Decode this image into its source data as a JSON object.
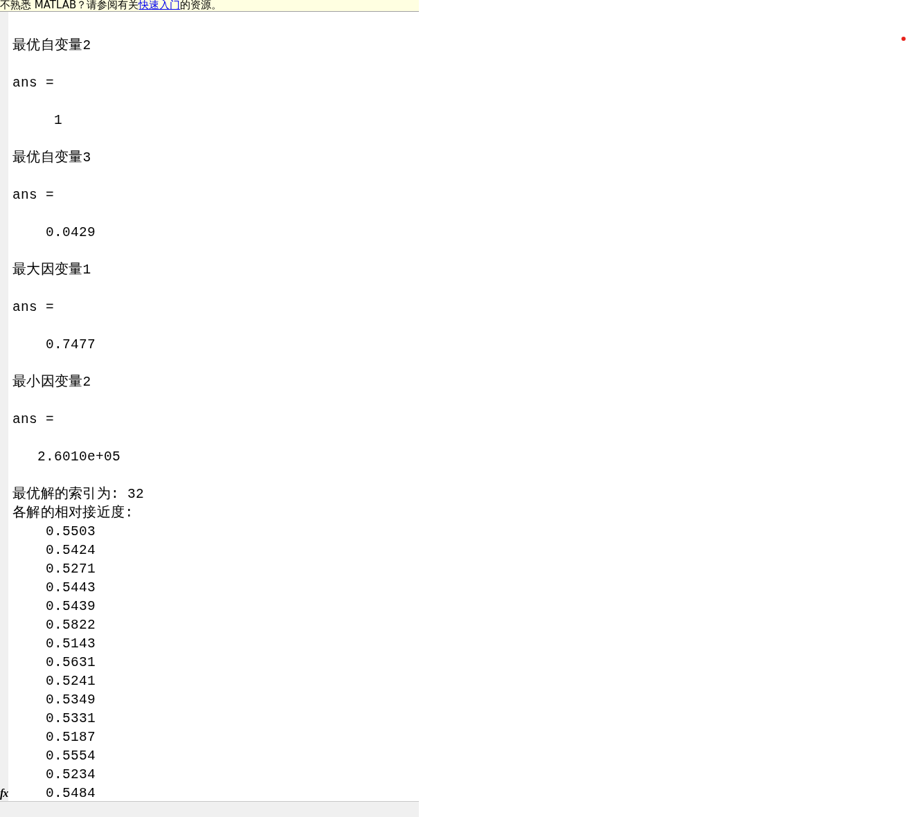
{
  "prompt_icon": "fx",
  "banner": {
    "before": "不熟悉 MATLAB？请参阅有关",
    "link": "快速入门",
    "after": "的资源。"
  },
  "blocks": [
    {
      "lines": [
        "最优自变量2"
      ]
    },
    {
      "lines": [
        "ans ="
      ]
    },
    {
      "lines": [
        "     1"
      ]
    },
    {
      "lines": [
        "最优自变量3"
      ]
    },
    {
      "lines": [
        "ans ="
      ]
    },
    {
      "lines": [
        "    0.0429"
      ]
    },
    {
      "lines": [
        "最大因变量1"
      ]
    },
    {
      "lines": [
        "ans ="
      ]
    },
    {
      "lines": [
        "    0.7477"
      ]
    },
    {
      "lines": [
        "最小因变量2"
      ]
    },
    {
      "lines": [
        "ans ="
      ]
    },
    {
      "lines": [
        "   2.6010e+05"
      ]
    },
    {
      "lines": [
        "最优解的索引为: 32",
        "各解的相对接近度:",
        "    0.5503",
        "    0.5424",
        "    0.5271",
        "    0.5443",
        "    0.5439",
        "    0.5822",
        "    0.5143",
        "    0.5631",
        "    0.5241",
        "    0.5349",
        "    0.5331",
        "    0.5187",
        "    0.5554",
        "    0.5234",
        "    0.5484"
      ]
    }
  ]
}
